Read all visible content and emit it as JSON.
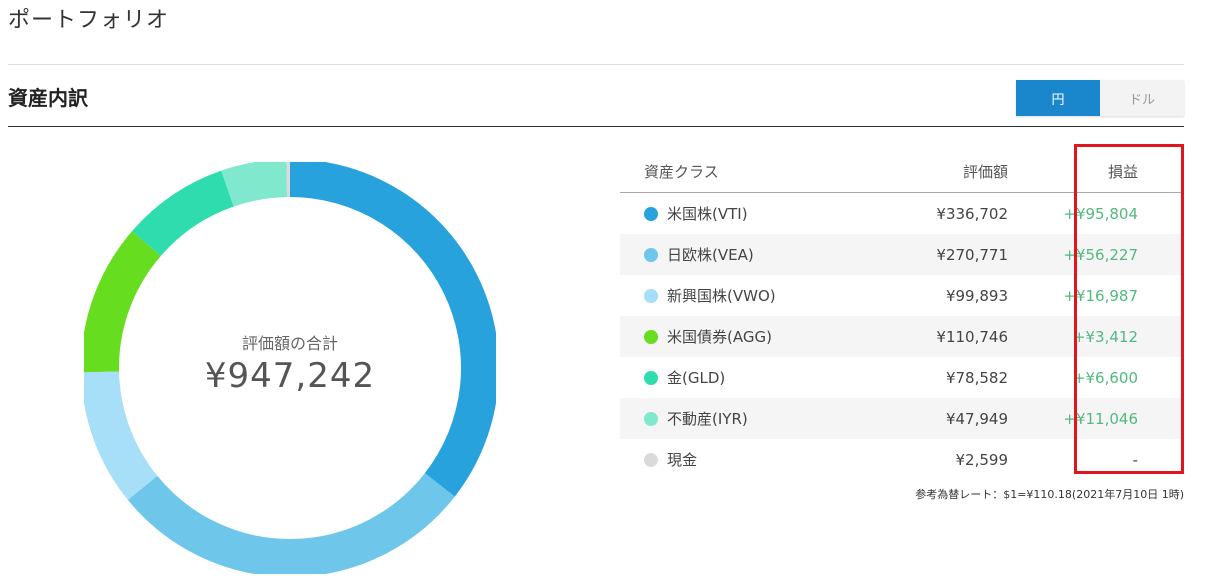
{
  "header": {
    "title": "ポートフォリオ"
  },
  "section": {
    "title": "資産内訳"
  },
  "currency_toggle": {
    "yen_label": "円",
    "usd_label": "ドル",
    "selected": "円"
  },
  "donut": {
    "label": "評価額の合計",
    "total": "¥947,242",
    "segments": [
      {
        "name": "米国株(VTI)",
        "value": 336702,
        "color": "#27a2dc"
      },
      {
        "name": "日欧株(VEA)",
        "value": 270771,
        "color": "#6ec6ea"
      },
      {
        "name": "新興国株(VWO)",
        "value": 99893,
        "color": "#a7def8"
      },
      {
        "name": "米国債券(AGG)",
        "value": 110746,
        "color": "#66dd1e"
      },
      {
        "name": "金(GLD)",
        "value": 78582,
        "color": "#2fdcae"
      },
      {
        "name": "不動産(IYR)",
        "value": 47949,
        "color": "#80e8cc"
      },
      {
        "name": "現金",
        "value": 2599,
        "color": "#dadada"
      }
    ]
  },
  "table": {
    "headers": {
      "class": "資産クラス",
      "value": "評価額",
      "gain": "損益"
    },
    "rows": [
      {
        "name": "米国株(VTI)",
        "value": "¥336,702",
        "gain": "+¥95,804",
        "color": "#27a2dc"
      },
      {
        "name": "日欧株(VEA)",
        "value": "¥270,771",
        "gain": "+¥56,227",
        "color": "#6ec6ea"
      },
      {
        "name": "新興国株(VWO)",
        "value": "¥99,893",
        "gain": "+¥16,987",
        "color": "#a7def8"
      },
      {
        "name": "米国債券(AGG)",
        "value": "¥110,746",
        "gain": "+¥3,412",
        "color": "#66dd1e"
      },
      {
        "name": "金(GLD)",
        "value": "¥78,582",
        "gain": "+¥6,600",
        "color": "#2fdcae"
      },
      {
        "name": "不動産(IYR)",
        "value": "¥47,949",
        "gain": "+¥11,046",
        "color": "#80e8cc"
      },
      {
        "name": "現金",
        "value": "¥2,599",
        "gain": "-",
        "color": "#dadada"
      }
    ]
  },
  "fx_note": "参考為替レート：$1=¥110.18(2021年7月10日 1時)",
  "colors": {
    "accent": "#1a86cc",
    "gain": "#52b97f",
    "highlight": "#e0151e"
  }
}
